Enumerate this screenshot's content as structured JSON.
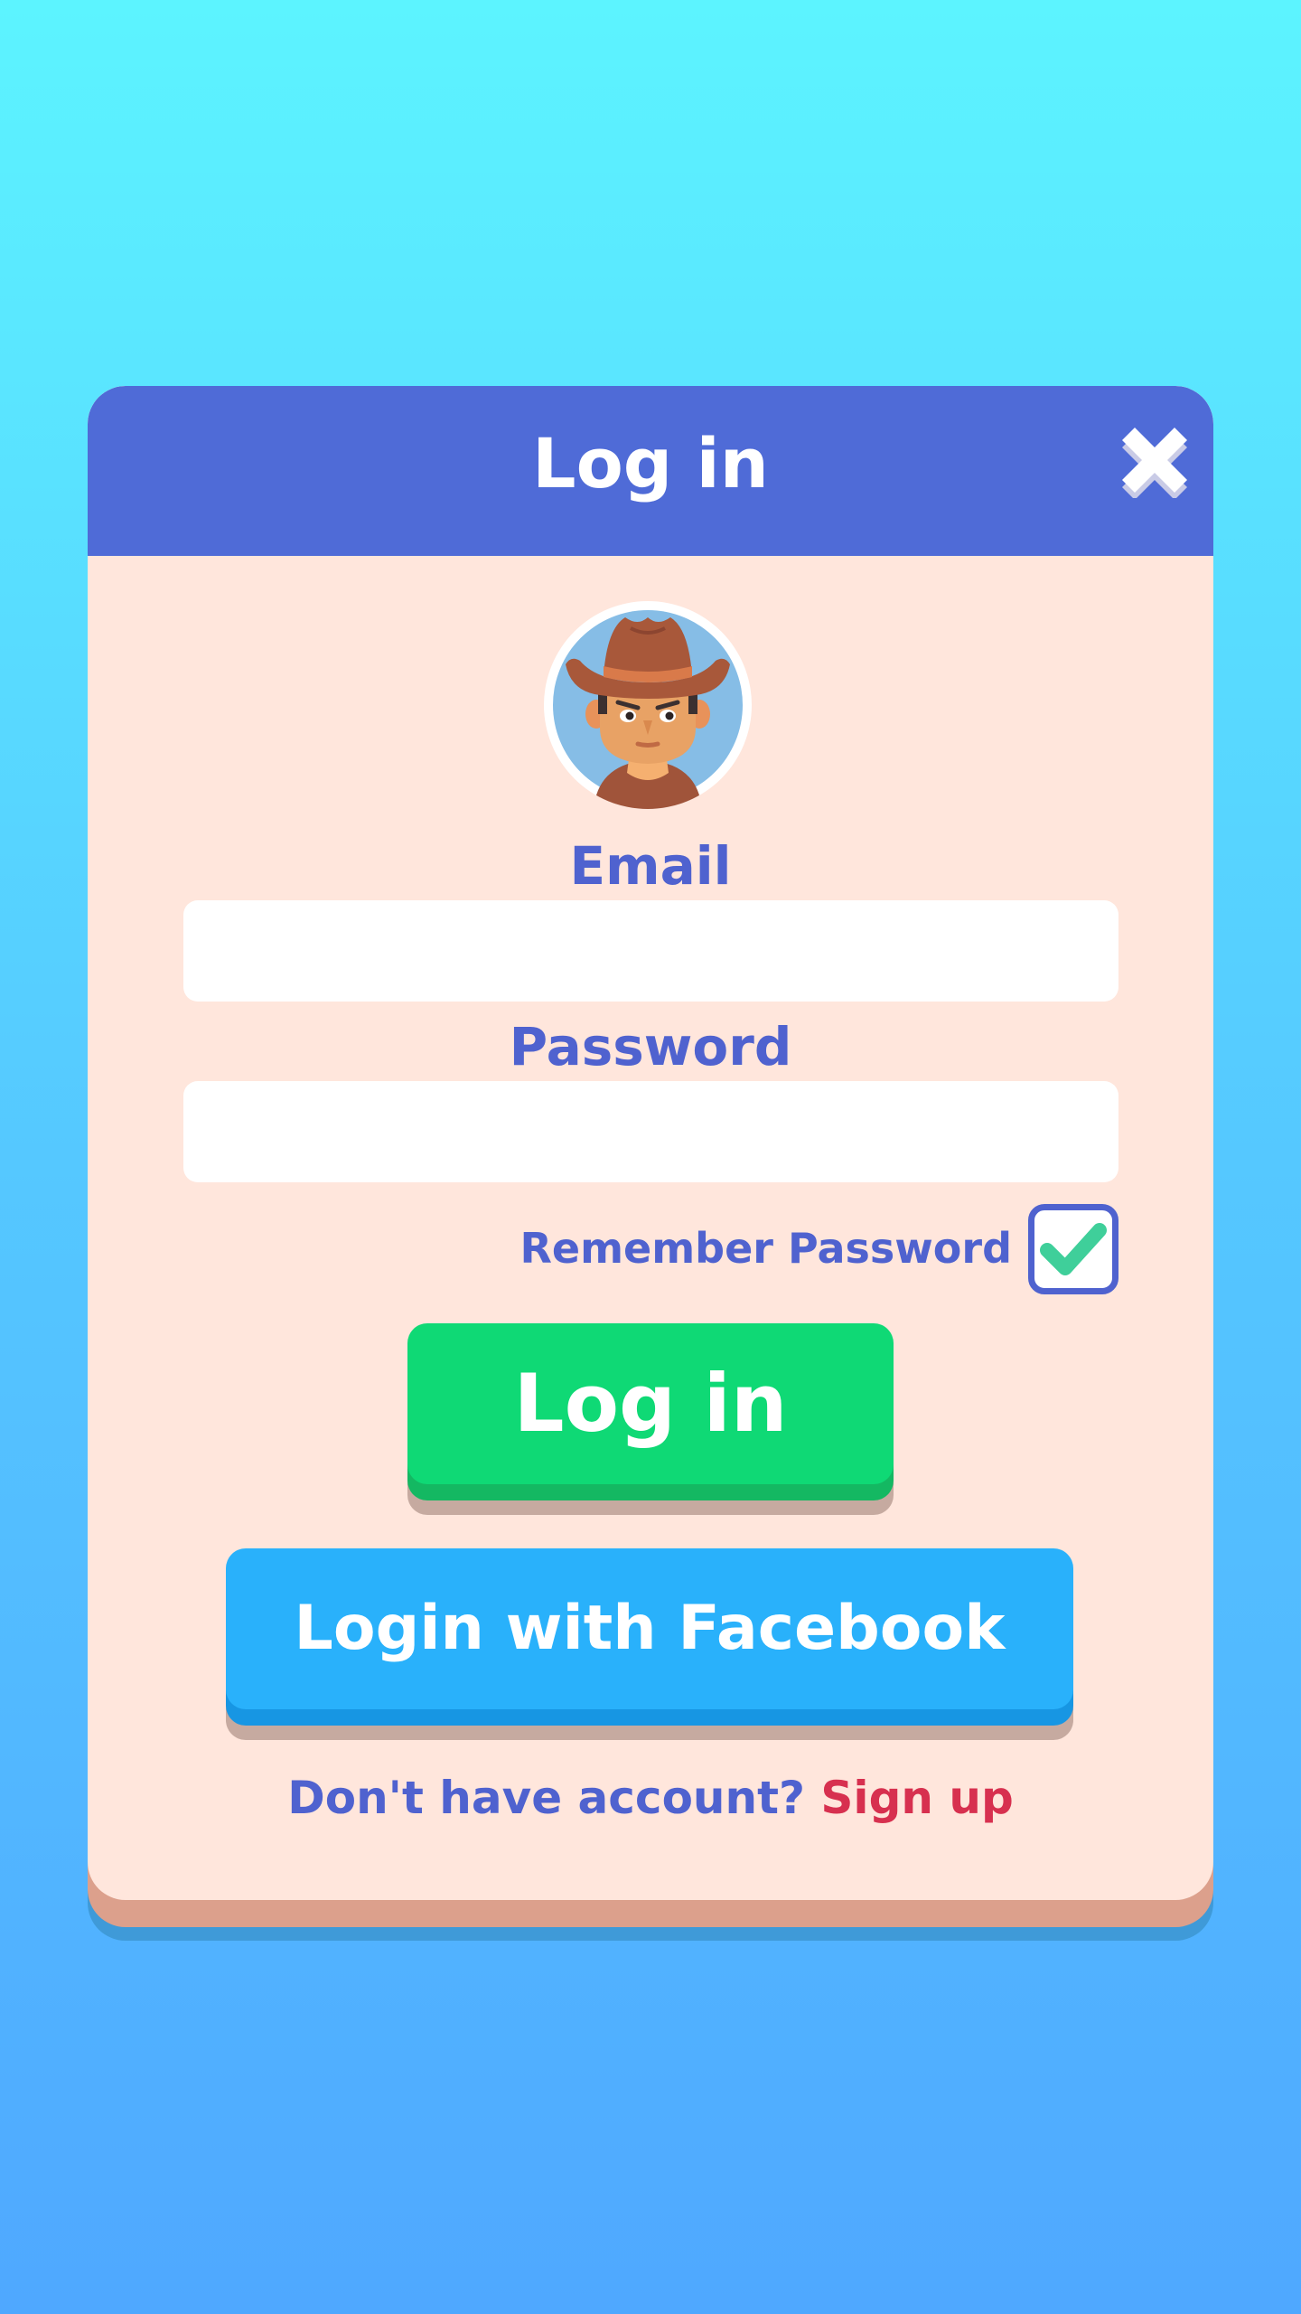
{
  "dialog": {
    "title": "Log in",
    "close_icon": "close-icon"
  },
  "avatar": {
    "icon": "cowboy-avatar-icon"
  },
  "form": {
    "email_label": "Email",
    "email_value": "",
    "password_label": "Password",
    "password_value": "",
    "remember_label": "Remember Password",
    "remember_checked": true
  },
  "buttons": {
    "login_label": "Log in",
    "facebook_label": "Login with Facebook"
  },
  "footer": {
    "prompt": "Don't have account?",
    "signup_label": "Sign up"
  },
  "colors": {
    "header": "#4f6bd7",
    "panel": "#ffe6dc",
    "text_accent": "#4f62cf",
    "login_button": "#0fd975",
    "facebook_button": "#29b1fb",
    "signup_link": "#d7304f",
    "check": "#3fcf9a"
  }
}
